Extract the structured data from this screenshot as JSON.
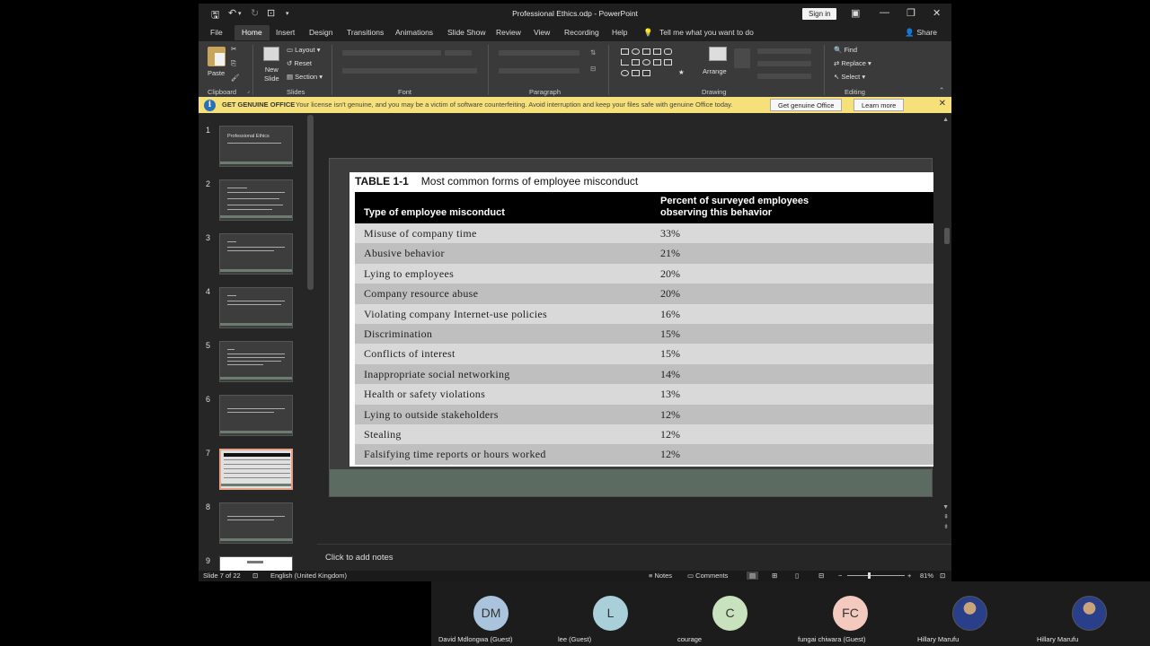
{
  "window": {
    "title": "Professional Ethics.odp  -  PowerPoint",
    "sign_in": "Sign in"
  },
  "ribbon_tabs": [
    "File",
    "Home",
    "Insert",
    "Design",
    "Transitions",
    "Animations",
    "Slide Show",
    "Review",
    "View",
    "Recording",
    "Help"
  ],
  "tell_me": "Tell me what you want to do",
  "share": "Share",
  "ribbon": {
    "paste": "Paste",
    "new_slide": "New\nSlide",
    "layout": "Layout",
    "reset": "Reset",
    "section": "Section",
    "arrange": "Arrange",
    "find": "Find",
    "replace": "Replace",
    "select": "Select",
    "groups": [
      "Clipboard",
      "Slides",
      "Font",
      "Paragraph",
      "Drawing",
      "Editing"
    ]
  },
  "warning_bar": {
    "title": "GET GENUINE OFFICE",
    "message": "Your license isn't genuine, and you may be a victim of software counterfeiting. Avoid interruption and keep your files safe with genuine Office today.",
    "button_genuine": "Get genuine Office",
    "button_learn": "Learn more"
  },
  "thumbnails": {
    "numbers": [
      "1",
      "2",
      "3",
      "4",
      "5",
      "6",
      "7",
      "8",
      "9"
    ],
    "first_title": "Professional Ethics",
    "selected": "7"
  },
  "slide": {
    "table_number": "TABLE 1-1",
    "table_title": "Most common forms of employee misconduct",
    "col1_header": "Type of employee misconduct",
    "col2_header_line1": "Percent of surveyed employees",
    "col2_header_line2": "observing this behavior",
    "rows": [
      {
        "type": "Misuse of company time",
        "pct": "33%"
      },
      {
        "type": "Abusive behavior",
        "pct": "21%"
      },
      {
        "type": "Lying to employees",
        "pct": "20%"
      },
      {
        "type": "Company resource abuse",
        "pct": "20%"
      },
      {
        "type": "Violating company Internet-use policies",
        "pct": "16%"
      },
      {
        "type": "Discrimination",
        "pct": "15%"
      },
      {
        "type": "Conflicts of interest",
        "pct": "15%"
      },
      {
        "type": "Inappropriate social networking",
        "pct": "14%"
      },
      {
        "type": "Health or safety violations",
        "pct": "13%"
      },
      {
        "type": "Lying to outside stakeholders",
        "pct": "12%"
      },
      {
        "type": "Stealing",
        "pct": "12%"
      },
      {
        "type": "Falsifying time reports or hours worked",
        "pct": "12%"
      }
    ]
  },
  "notes_placeholder": "Click to add notes",
  "status": {
    "slide_count": "Slide 7 of 22",
    "language": "English (United Kingdom)",
    "notes": "Notes",
    "comments": "Comments",
    "zoom": "81%"
  },
  "participants": [
    {
      "initials": "DM",
      "name": "David Mdlongwa (Guest)",
      "color": "#a9c4dc"
    },
    {
      "initials": "L",
      "name": "lee (Guest)",
      "color": "#a9d0d8"
    },
    {
      "initials": "C",
      "name": "courage",
      "color": "#c8e2bd"
    },
    {
      "initials": "FC",
      "name": "fungai chiwara (Guest)",
      "color": "#f4c9be"
    },
    {
      "initials": "",
      "name": "Hillary Marufu"
    },
    {
      "initials": "",
      "name": "Hillary Marufu"
    }
  ]
}
